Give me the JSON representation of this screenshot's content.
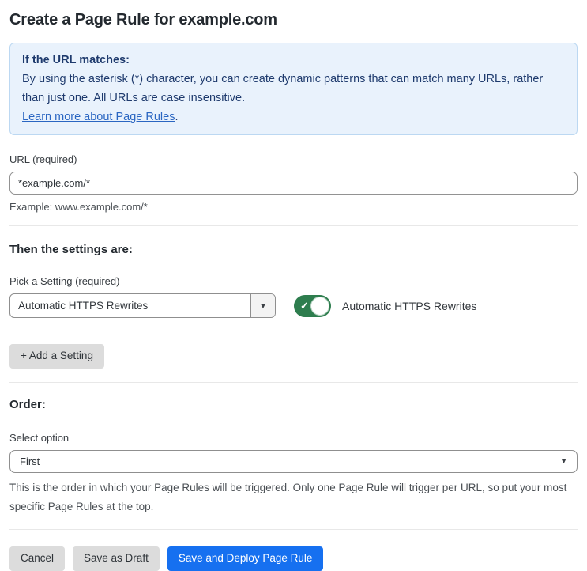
{
  "page": {
    "title": "Create a Page Rule for example.com"
  },
  "info_box": {
    "heading": "If the URL matches:",
    "body": "By using the asterisk (*) character, you can create dynamic patterns that can match many URLs, rather than just one. All URLs are case insensitive.",
    "link_label": "Learn more about Page Rules",
    "link_suffix": "."
  },
  "url_field": {
    "label": "URL (required)",
    "value": "*example.com/*",
    "helper": "Example: www.example.com/*"
  },
  "settings": {
    "heading": "Then the settings are:",
    "picker_label": "Pick a Setting (required)",
    "picker_value": "Automatic HTTPS Rewrites",
    "dropdown_arrow_glyph": "▼",
    "toggle_state": "on",
    "toggle_check_glyph": "✓",
    "toggle_label": "Automatic HTTPS Rewrites",
    "add_button_label": "+ Add a Setting"
  },
  "order": {
    "heading": "Order:",
    "select_label": "Select option",
    "select_value": "First",
    "select_arrow_glyph": "▼",
    "helper": "This is the order in which your Page Rules will be triggered. Only one Page Rule will trigger per URL, so put your most specific Page Rules at the top."
  },
  "footer": {
    "cancel_label": "Cancel",
    "save_draft_label": "Save as Draft",
    "save_deploy_label": "Save and Deploy Page Rule"
  },
  "colors": {
    "accent_blue": "#1670f0",
    "toggle_green": "#2e7d4e",
    "info_bg": "#e9f2fc",
    "info_border": "#bcd8f2",
    "info_text": "#1e3a6d",
    "link_blue": "#2a66c2"
  }
}
